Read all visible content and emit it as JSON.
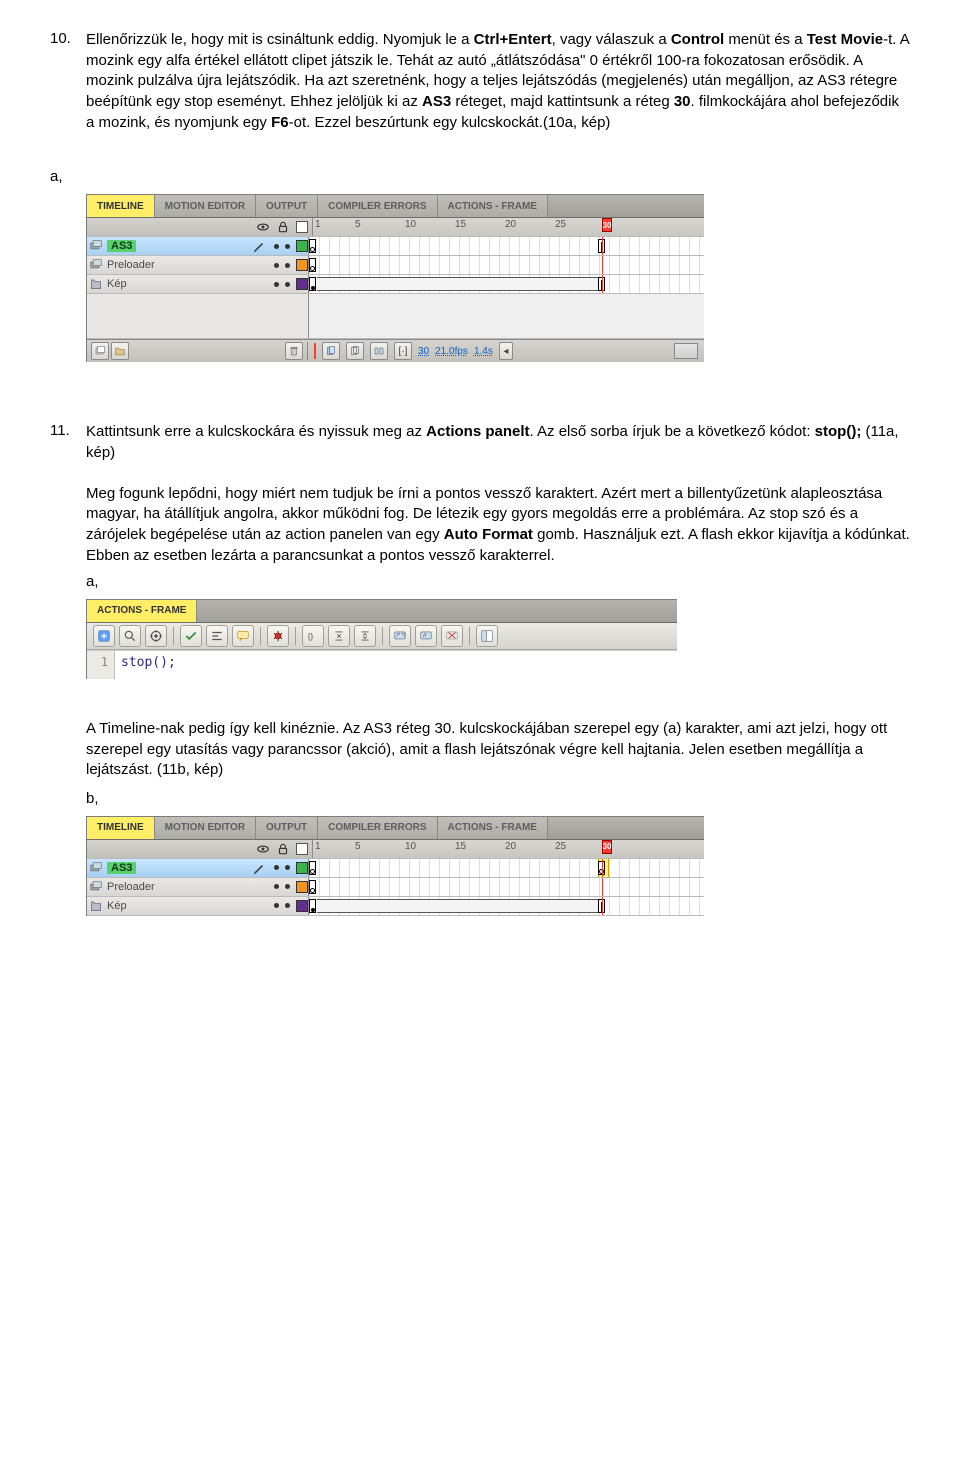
{
  "items": {
    "ten": {
      "number": "10.",
      "p1a": "Ellenőrizzük le, hogy mit is csináltunk eddig. Nyomjuk le a ",
      "p1b": "Ctrl+Entert",
      "p1c": ", vagy válaszuk a ",
      "p1d": "Control",
      "p1e": " menüt és a ",
      "p1f": "Test Movie",
      "p1g": "-t. A mozink egy alfa értékel ellátott clipet játszik le. Tehát az autó „átlátszódása\" 0 értékről 100-ra fokozatosan erősödik. A mozink pulzálva újra lejátszódik. Ha azt szeretnénk, hogy a teljes lejátszódás (megjelenés) után megálljon, az AS3 rétegre beépítünk egy stop eseményt. Ehhez jelöljük ki az ",
      "p1h": "AS3",
      "p1i": " réteget, majd kattintsunk a réteg ",
      "p1j": "30",
      "p1k": ". filmkockájára ahol befejeződik a mozink, és nyomjunk egy ",
      "p1l": "F6",
      "p1m": "-ot. Ezzel beszúrtunk egy kulcskockát.(10a, kép)"
    },
    "eleven": {
      "number": "11.",
      "p1a": "Kattintsunk erre a kulcskockára és nyissuk meg az ",
      "p1b": "Actions panelt",
      "p1c": ". Az első sorba írjuk be a következő kódot: ",
      "p1d": "stop();",
      "p1e": "  (11a, kép)",
      "p2a": "Meg fogunk lepődni, hogy miért nem tudjuk be írni a pontos vessző karaktert. Azért mert a billentyűzetünk alapleosztása magyar, ha átállítjuk angolra, akkor működni fog. De létezik egy gyors megoldás erre a problémára. Az stop szó és a zárójelek begépelése után az action panelen van egy ",
      "p2b": "Auto Format",
      "p2c": " gomb. Használjuk ezt. A flash ekkor kijavítja a kódúnkat. Ebben az esetben lezárta a parancsunkat a pontos vessző karakterrel.",
      "p3": "A Timeline-nak pedig így kell kinéznie. Az AS3 réteg 30. kulcskockájában szerepel egy (a) karakter, ami azt jelzi, hogy ott szerepel egy utasítás vagy parancssor (akció), amit a flash lejátszónak végre kell hajtania. Jelen esetben megállítja a lejátszást. (11b, kép)"
    }
  },
  "labels": {
    "a": "a,",
    "b": "b,"
  },
  "timeline": {
    "tabs": [
      "TIMELINE",
      "MOTION EDITOR",
      "OUTPUT",
      "COMPILER ERRORS",
      "ACTIONS - FRAME"
    ],
    "ruler": {
      "labels": [
        "1",
        "5",
        "10",
        "15",
        "20",
        "25",
        "30"
      ],
      "playhead_label": "30"
    },
    "layers": [
      {
        "name": "AS3",
        "color": "#39b44a",
        "selected": true
      },
      {
        "name": "Preloader",
        "color": "#f7941d",
        "selected": false
      },
      {
        "name": "Kép",
        "color": "#662d91",
        "selected": false
      }
    ],
    "footer": {
      "frame": "30",
      "fps": "21.0fps",
      "time": "1.4s"
    }
  },
  "actions": {
    "tab": "ACTIONS - FRAME",
    "line_no": "1",
    "code": "stop();"
  }
}
